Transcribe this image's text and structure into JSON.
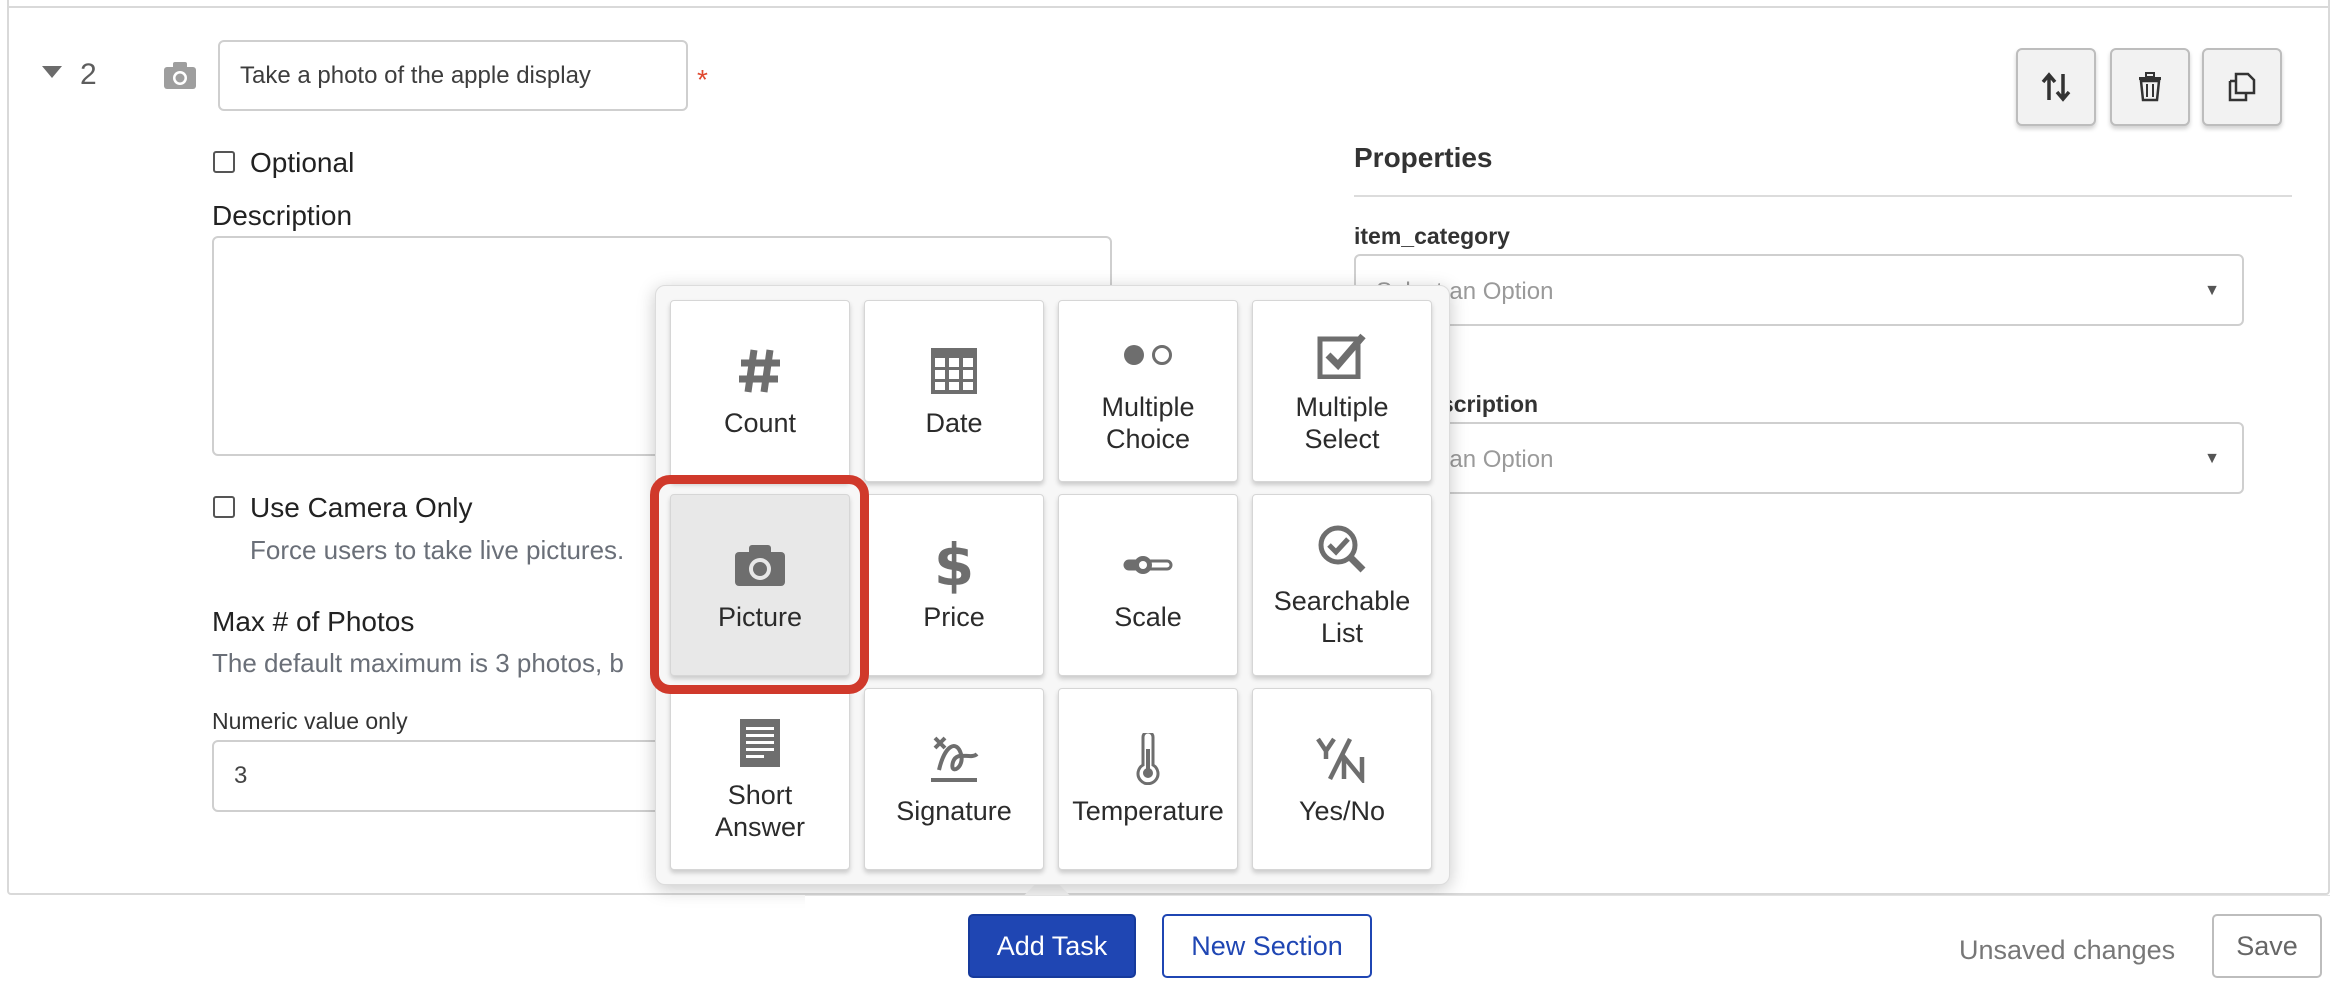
{
  "task": {
    "number": "2",
    "title_value": "Take a photo of the apple display",
    "required_marker": "*"
  },
  "form": {
    "optional_label": "Optional",
    "description_label": "Description",
    "use_camera_label": "Use Camera Only",
    "use_camera_hint": "Force users to take live pictures.",
    "max_photos_label": "Max # of Photos",
    "max_photos_hint": "The default maximum is 3 photos, b",
    "numeric_label": "Numeric value only",
    "numeric_value": "3"
  },
  "properties": {
    "heading": "Properties",
    "fields": [
      {
        "label": "item_category",
        "placeholder": "Select an Option"
      },
      {
        "label": "item_description",
        "placeholder": "Select an Option"
      }
    ]
  },
  "task_types": [
    {
      "label": "Count",
      "icon": "hash-icon"
    },
    {
      "label": "Date",
      "icon": "calendar-icon"
    },
    {
      "label": "Multiple Choice",
      "icon": "radio-choice-icon"
    },
    {
      "label": "Multiple Select",
      "icon": "checkbox-select-icon"
    },
    {
      "label": "Picture",
      "icon": "camera-icon",
      "selected": true
    },
    {
      "label": "Price",
      "icon": "dollar-icon"
    },
    {
      "label": "Scale",
      "icon": "slider-icon"
    },
    {
      "label": "Searchable List",
      "icon": "search-check-icon"
    },
    {
      "label": "Short Answer",
      "icon": "document-lines-icon"
    },
    {
      "label": "Signature",
      "icon": "signature-icon"
    },
    {
      "label": "Temperature",
      "icon": "thermometer-icon"
    },
    {
      "label": "Yes/No",
      "icon": "yes-no-icon"
    }
  ],
  "footer": {
    "add_task": "Add Task",
    "new_section": "New Section",
    "status": "Unsaved changes",
    "save": "Save"
  },
  "colors": {
    "primary": "#1f46b3",
    "highlight": "#d0392b",
    "required": "#e0492f"
  }
}
